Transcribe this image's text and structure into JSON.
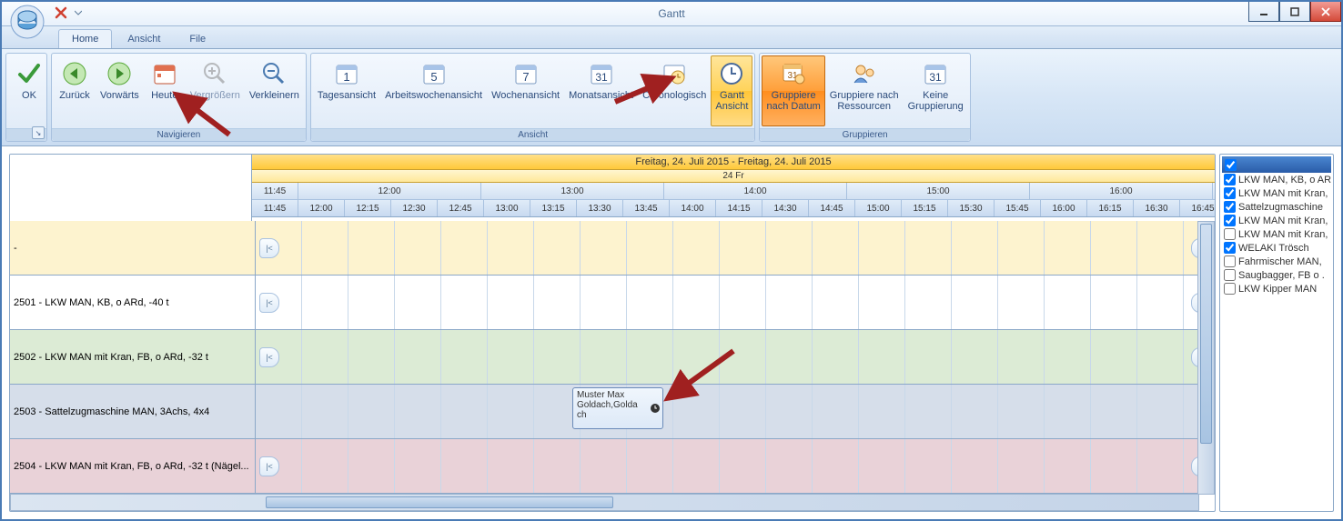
{
  "window": {
    "title": "Gantt"
  },
  "tabs": {
    "home": "Home",
    "ansicht": "Ansicht",
    "file": "File"
  },
  "ribbon": {
    "ok": "OK",
    "nav": {
      "back": "Zurück",
      "forward": "Vorwärts",
      "today": "Heute",
      "zoom_in": "Vergrößern",
      "zoom_out": "Verkleinern",
      "group_label": "Navigieren"
    },
    "view": {
      "day": "Tagesansicht",
      "workweek": "Arbeitswochenansicht",
      "week": "Wochenansicht",
      "month": "Monatsansicht",
      "chrono": "Chronologisch",
      "gantt": "Gantt\nAnsicht",
      "group_label": "Ansicht"
    },
    "group": {
      "by_date": "Gruppiere\nnach Datum",
      "by_res": "Gruppiere nach\nRessourcen",
      "none": "Keine\nGruppierung",
      "group_label": "Gruppieren"
    }
  },
  "gantt": {
    "range_label": "Freitag, 24. Juli 2015 - Freitag, 24. Juli 2015",
    "day_label": "24 Fr",
    "hour_first": "11:45",
    "hours": [
      "12:00",
      "13:00",
      "14:00",
      "15:00",
      "16:00"
    ],
    "min_first": "11:45",
    "mins": [
      "12:00",
      "12:15",
      "12:30",
      "12:45",
      "13:00",
      "13:15",
      "13:30",
      "13:45",
      "14:00",
      "14:15",
      "14:30",
      "14:45",
      "15:00",
      "15:15",
      "15:30",
      "15:45",
      "16:00",
      "16:15",
      "16:30",
      "16:45"
    ],
    "rows": [
      {
        "label": "-",
        "bg": "#fdf3cf",
        "left_nav": true,
        "right_nav": true
      },
      {
        "label": "2501 - LKW MAN, KB, o ARd, -40 t",
        "bg": "#ffffff",
        "left_nav": true,
        "right_nav": true
      },
      {
        "label": "2502 - LKW MAN mit Kran, FB, o ARd, -32 t",
        "bg": "#dcebd5",
        "left_nav": true,
        "right_nav": true
      },
      {
        "label": "2503 - Sattelzugmaschine MAN, 3Achs, 4x4",
        "bg": "#d6deea",
        "left_nav": false,
        "right_nav": false
      },
      {
        "label": "2504 - LKW MAN mit Kran, FB, o ARd, -32 t (Nägel...",
        "bg": "#e9d2d8",
        "left_nav": true,
        "right_nav": true
      }
    ],
    "event": {
      "line1": "Muster Max",
      "line2": "Goldach,Golda",
      "line3": "ch"
    }
  },
  "side": {
    "items": [
      {
        "checked": true,
        "label": "LKW MAN, KB, o ARd"
      },
      {
        "checked": true,
        "label": "LKW MAN mit Kran,"
      },
      {
        "checked": true,
        "label": "Sattelzugmaschine"
      },
      {
        "checked": true,
        "label": "LKW MAN mit Kran,"
      },
      {
        "checked": false,
        "label": "LKW MAN mit Kran,"
      },
      {
        "checked": true,
        "label": "WELAKI Trösch"
      },
      {
        "checked": false,
        "label": "Fahrmischer MAN,"
      },
      {
        "checked": false,
        "label": "Saugbagger, FB o ."
      },
      {
        "checked": false,
        "label": "LKW Kipper MAN"
      }
    ]
  }
}
